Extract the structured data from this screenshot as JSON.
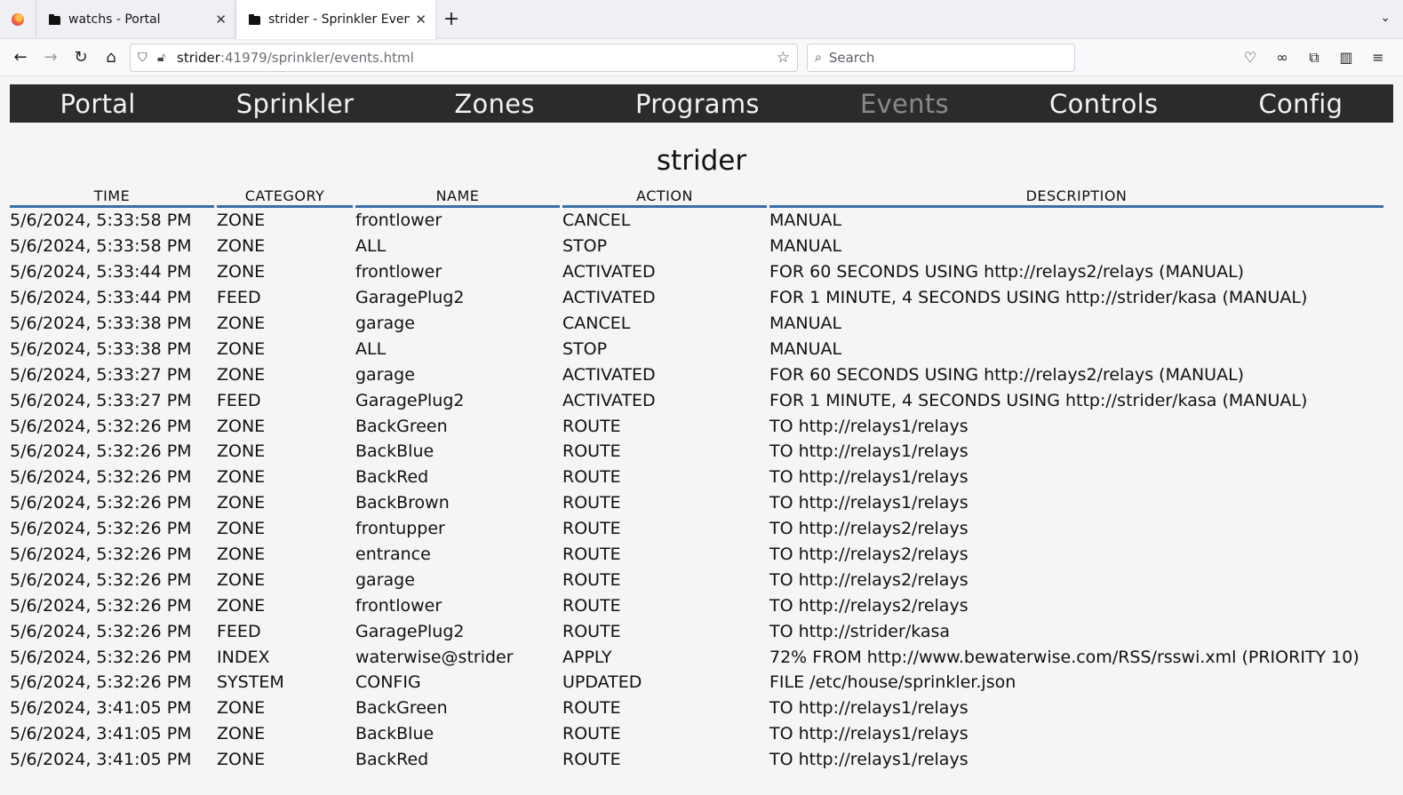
{
  "browser": {
    "tabs": [
      {
        "title": "watchs - Portal",
        "active": false
      },
      {
        "title": "strider - Sprinkler Events",
        "active": true
      }
    ],
    "url_host": "strider",
    "url_rest": ":41979/sprinkler/events.html",
    "search_placeholder": "Search"
  },
  "menu": {
    "items": [
      "Portal",
      "Sprinkler",
      "Zones",
      "Programs",
      "Events",
      "Controls",
      "Config"
    ],
    "current": "Events"
  },
  "page": {
    "title": "strider"
  },
  "table": {
    "headers": [
      "TIME",
      "CATEGORY",
      "NAME",
      "ACTION",
      "DESCRIPTION"
    ],
    "rows": [
      [
        "5/6/2024, 5:33:58 PM",
        "ZONE",
        "frontlower",
        "CANCEL",
        "MANUAL"
      ],
      [
        "5/6/2024, 5:33:58 PM",
        "ZONE",
        "ALL",
        "STOP",
        "MANUAL"
      ],
      [
        "5/6/2024, 5:33:44 PM",
        "ZONE",
        "frontlower",
        "ACTIVATED",
        "FOR 60 SECONDS USING http://relays2/relays (MANUAL)"
      ],
      [
        "5/6/2024, 5:33:44 PM",
        "FEED",
        "GaragePlug2",
        "ACTIVATED",
        "FOR 1 MINUTE, 4 SECONDS USING http://strider/kasa (MANUAL)"
      ],
      [
        "5/6/2024, 5:33:38 PM",
        "ZONE",
        "garage",
        "CANCEL",
        "MANUAL"
      ],
      [
        "5/6/2024, 5:33:38 PM",
        "ZONE",
        "ALL",
        "STOP",
        "MANUAL"
      ],
      [
        "5/6/2024, 5:33:27 PM",
        "ZONE",
        "garage",
        "ACTIVATED",
        "FOR 60 SECONDS USING http://relays2/relays (MANUAL)"
      ],
      [
        "5/6/2024, 5:33:27 PM",
        "FEED",
        "GaragePlug2",
        "ACTIVATED",
        "FOR 1 MINUTE, 4 SECONDS USING http://strider/kasa (MANUAL)"
      ],
      [
        "5/6/2024, 5:32:26 PM",
        "ZONE",
        "BackGreen",
        "ROUTE",
        "TO http://relays1/relays"
      ],
      [
        "5/6/2024, 5:32:26 PM",
        "ZONE",
        "BackBlue",
        "ROUTE",
        "TO http://relays1/relays"
      ],
      [
        "5/6/2024, 5:32:26 PM",
        "ZONE",
        "BackRed",
        "ROUTE",
        "TO http://relays1/relays"
      ],
      [
        "5/6/2024, 5:32:26 PM",
        "ZONE",
        "BackBrown",
        "ROUTE",
        "TO http://relays1/relays"
      ],
      [
        "5/6/2024, 5:32:26 PM",
        "ZONE",
        "frontupper",
        "ROUTE",
        "TO http://relays2/relays"
      ],
      [
        "5/6/2024, 5:32:26 PM",
        "ZONE",
        "entrance",
        "ROUTE",
        "TO http://relays2/relays"
      ],
      [
        "5/6/2024, 5:32:26 PM",
        "ZONE",
        "garage",
        "ROUTE",
        "TO http://relays2/relays"
      ],
      [
        "5/6/2024, 5:32:26 PM",
        "ZONE",
        "frontlower",
        "ROUTE",
        "TO http://relays2/relays"
      ],
      [
        "5/6/2024, 5:32:26 PM",
        "FEED",
        "GaragePlug2",
        "ROUTE",
        "TO http://strider/kasa"
      ],
      [
        "5/6/2024, 5:32:26 PM",
        "INDEX",
        "waterwise@strider",
        "APPLY",
        "72% FROM http://www.bewaterwise.com/RSS/rsswi.xml (PRIORITY 10)"
      ],
      [
        "5/6/2024, 5:32:26 PM",
        "SYSTEM",
        "CONFIG",
        "UPDATED",
        "FILE /etc/house/sprinkler.json"
      ],
      [
        "5/6/2024, 3:41:05 PM",
        "ZONE",
        "BackGreen",
        "ROUTE",
        "TO http://relays1/relays"
      ],
      [
        "5/6/2024, 3:41:05 PM",
        "ZONE",
        "BackBlue",
        "ROUTE",
        "TO http://relays1/relays"
      ],
      [
        "5/6/2024, 3:41:05 PM",
        "ZONE",
        "BackRed",
        "ROUTE",
        "TO http://relays1/relays"
      ]
    ]
  },
  "colors": {
    "menu_bg": "#2b2b2b",
    "menu_text": "#f2f2f2",
    "menu_current": "#8a8a8a",
    "header_rule": "#3c6ea8"
  }
}
